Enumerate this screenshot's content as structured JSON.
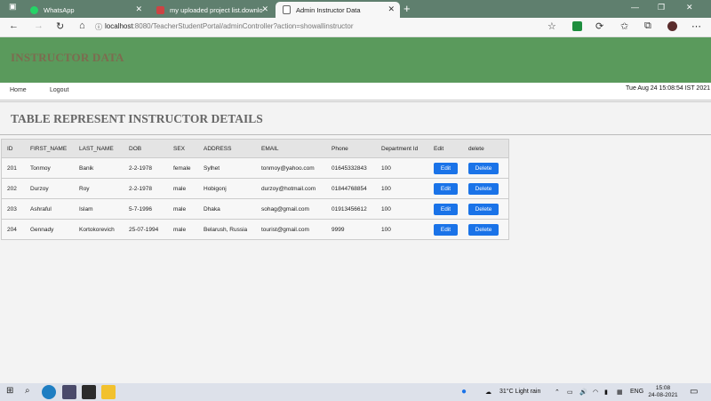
{
  "browser": {
    "tabs": [
      {
        "label": "WhatsApp",
        "active": false,
        "icon": "whatsapp-icon"
      },
      {
        "label": "my uploaded project list.downlo",
        "active": false,
        "icon": "document-icon"
      },
      {
        "label": "Admin Instructor Data",
        "active": true,
        "icon": "page-icon"
      }
    ],
    "address": {
      "host": "localhost",
      "path": ":8080/TeacherStudentPortal/adminController?action=showallinstructor"
    }
  },
  "page": {
    "banner_title": "INSTRUCTOR DATA",
    "nav": {
      "home": "Home",
      "logout": "Logout"
    },
    "date": "Tue Aug 24 15:08:54 IST 2021",
    "heading": "TABLE REPRESENT INSTRUCTOR DETAILS"
  },
  "table": {
    "columns": [
      "ID",
      "FIRST_NAME",
      "LAST_NAME",
      "DOB",
      "SEX",
      "ADDRESS",
      "EMAIL",
      "Phone",
      "Department Id",
      "Edit",
      "delete"
    ],
    "edit_label": "Edit",
    "delete_label": "Delete",
    "rows": [
      [
        "201",
        "Tonmoy",
        "Banik",
        "2-2-1978",
        "female",
        "Sylhet",
        "tonmoy@yahoo.com",
        "01645332843",
        "100"
      ],
      [
        "202",
        "Durzoy",
        "Roy",
        "2-2-1978",
        "male",
        "Hobigonj",
        "durzoy@hotmail.com",
        "01844768854",
        "100"
      ],
      [
        "203",
        "Ashraful",
        "Islam",
        "5-7-1996",
        "male",
        "Dhaka",
        "sohag@gmail.com",
        "01913456612",
        "100"
      ],
      [
        "204",
        "Gennady",
        "Kortokorevich",
        "25-07-1994",
        "male",
        "Belarush, Russia",
        "tourist@gmail.com",
        "9999",
        "100"
      ]
    ]
  },
  "taskbar": {
    "weather": "31°C  Light rain",
    "lang": "ENG",
    "time": "15:08",
    "date": "24-08-2021"
  },
  "colors": {
    "banner": "#5a9a5c",
    "button": "#1a73e8",
    "tabstrip": "#5f7f6e"
  }
}
